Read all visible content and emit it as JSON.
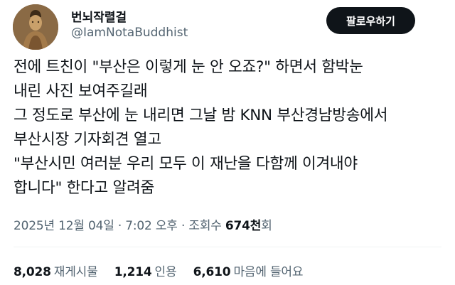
{
  "author": {
    "display_name": "번뇌작렬걸",
    "handle": "@IamNotaBuddhist",
    "avatar_icon": "buddha-statue-avatar"
  },
  "follow_label": "팔로우하기",
  "tweet": {
    "lines": [
      "전에 트친이 \"부산은 이렇게 눈 안 오죠?\" 하면서 함박눈",
      "내린 사진 보여주길래",
      "그 정도로 부산에 눈 내리면 그날 밤 KNN 부산경남방송에서",
      "부산시장 기자회견 열고",
      "\"부산시민 여러분 우리 모두 이 재난을 다함께 이겨내야",
      "합니다\" 한다고 알려줌"
    ]
  },
  "meta": {
    "date": "2025년 12월 04일",
    "sep": " · ",
    "time": "7:02 오후",
    "views_label": "조회수 ",
    "views_count": "674천",
    "views_suffix": "회"
  },
  "stats": {
    "reposts": {
      "count": "8,028",
      "label": "재게시물"
    },
    "quotes": {
      "count": "1,214",
      "label": "인용"
    },
    "likes": {
      "count": "6,610",
      "label": "마음에 들어요"
    }
  }
}
